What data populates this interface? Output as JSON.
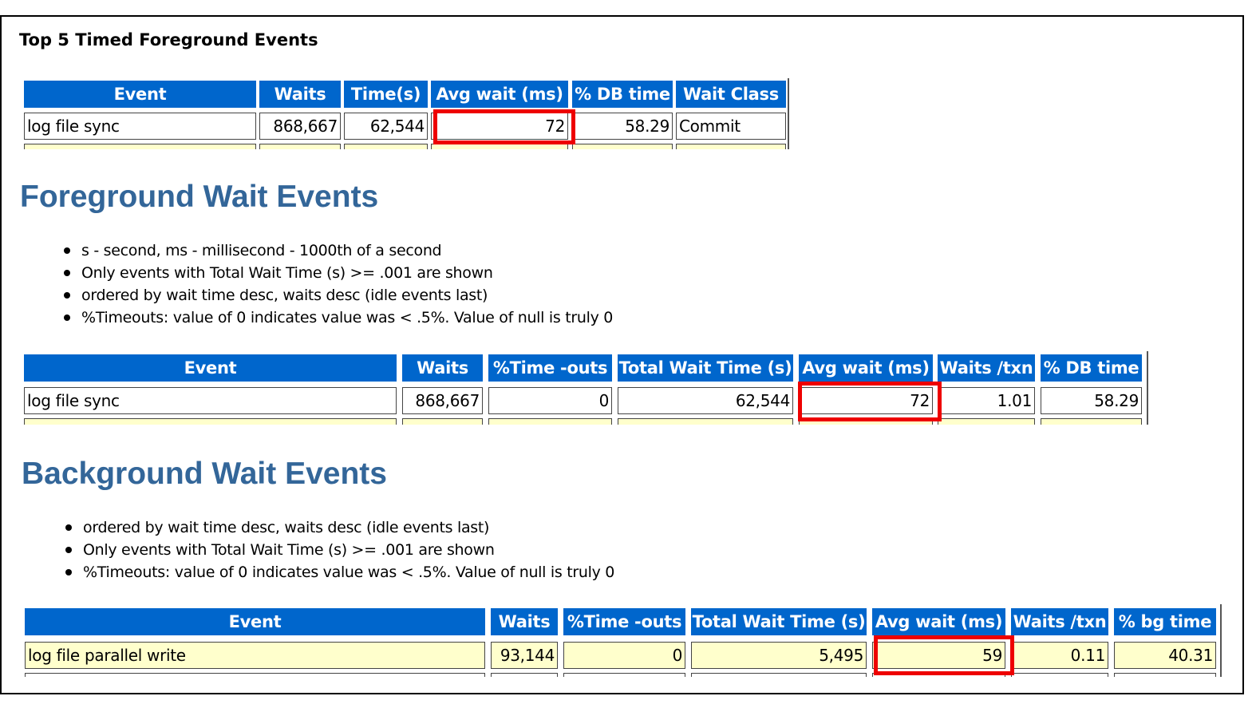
{
  "top5": {
    "title": "Top 5 Timed Foreground Events",
    "headers": [
      "Event",
      "Waits",
      "Time(s)",
      "Avg wait (ms)",
      "% DB time",
      "Wait Class"
    ],
    "row": [
      "log file sync",
      "868,667",
      "62,544",
      "72",
      "58.29",
      "Commit"
    ]
  },
  "foreground": {
    "title": "Foreground Wait Events",
    "bullets": [
      "s - second, ms - millisecond - 1000th of a second",
      "Only events with Total Wait Time (s) >= .001 are shown",
      "ordered by wait time desc, waits desc (idle events last)",
      "%Timeouts: value of 0 indicates value was < .5%. Value of null is truly 0"
    ],
    "headers": [
      "Event",
      "Waits",
      "%Time -outs",
      "Total Wait Time (s)",
      "Avg wait (ms)",
      "Waits /txn",
      "% DB time"
    ],
    "row": [
      "log file sync",
      "868,667",
      "0",
      "62,544",
      "72",
      "1.01",
      "58.29"
    ]
  },
  "background": {
    "title": "Background Wait Events",
    "bullets": [
      "ordered by wait time desc, waits desc (idle events last)",
      "Only events with Total Wait Time (s) >= .001 are shown",
      "%Timeouts: value of 0 indicates value was < .5%. Value of null is truly 0"
    ],
    "headers": [
      "Event",
      "Waits",
      "%Time -outs",
      "Total Wait Time (s)",
      "Avg wait (ms)",
      "Waits /txn",
      "% bg time"
    ],
    "row": [
      "log file parallel write",
      "93,144",
      "0",
      "5,495",
      "59",
      "0.11",
      "40.31"
    ]
  },
  "colors": {
    "header_bg": "#0066cc",
    "title_blue": "#336699",
    "highlight_red": "#ee0000",
    "row_yellow": "#ffffcc"
  }
}
